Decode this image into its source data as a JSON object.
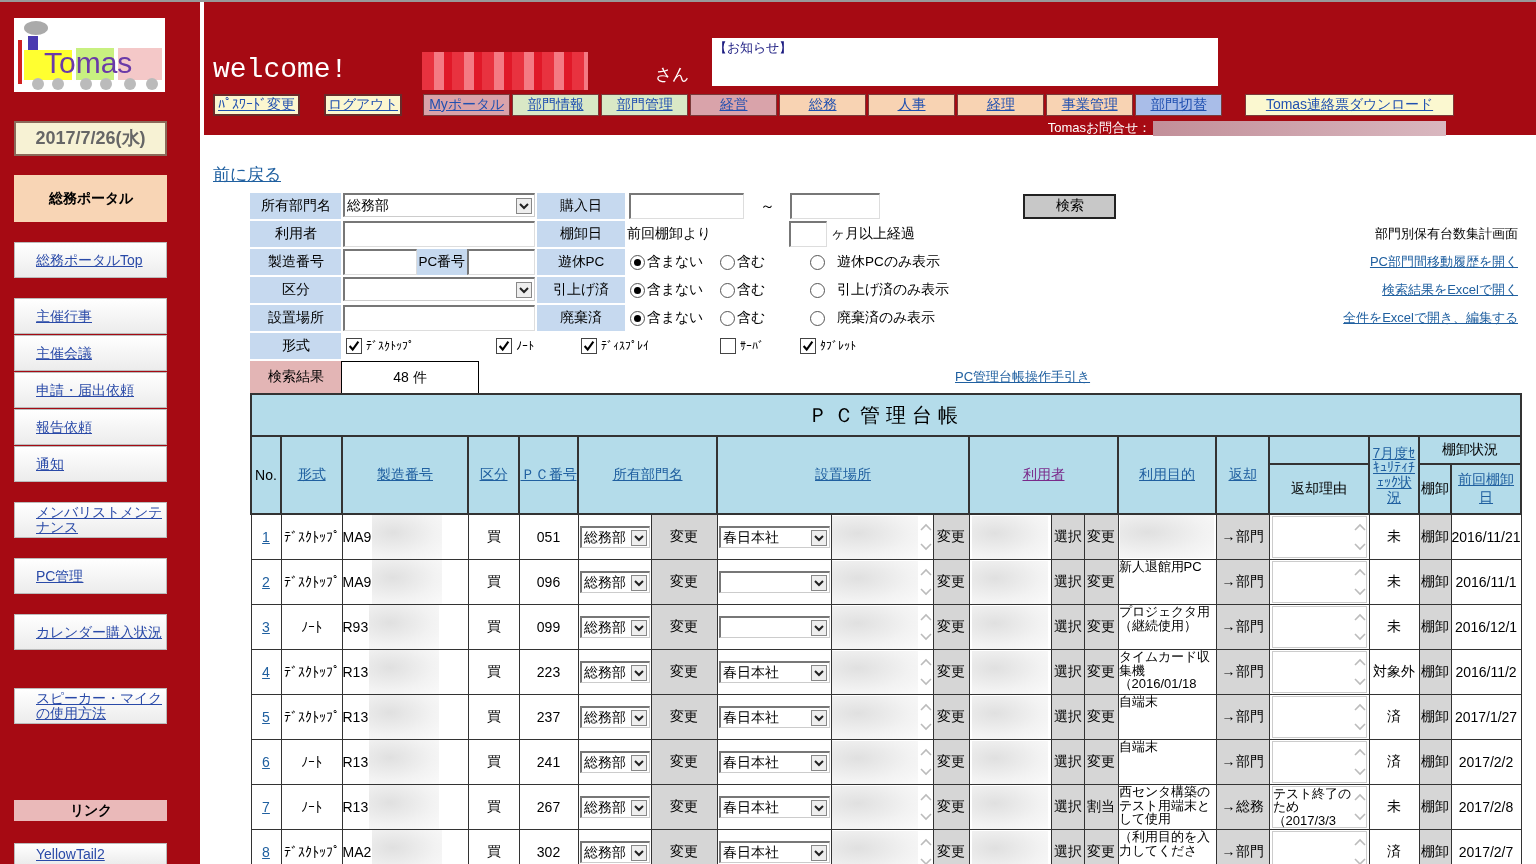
{
  "logo": {
    "text": "Tomas"
  },
  "sidebar": {
    "date": "2017/7/26(水)",
    "portal_title": "総務ポータル",
    "link_groups": [
      [
        "総務ポータルTop"
      ],
      [
        "主催行事",
        "主催会議",
        "申請・届出依頼",
        "報告依頼",
        "通知"
      ],
      [
        "メンバリストメンテナンス"
      ],
      [
        "PC管理"
      ],
      [
        "カレンダー購入状況"
      ],
      [
        "スピーカー・マイクの使用方法"
      ]
    ],
    "links_heading": "リンク",
    "external_links": [
      "YellowTail2"
    ]
  },
  "header": {
    "welcome": "welcome!",
    "honorific": "さん",
    "notice_title": "【お知らせ】",
    "nav": [
      {
        "label": "ﾊﾟｽﾜｰﾄﾞ変更",
        "kind": "account"
      },
      {
        "label": "ログアウト",
        "kind": "account"
      },
      {
        "label": "Myポータル",
        "kind": "tab",
        "color": "#d9a3aa"
      },
      {
        "label": "部門情報",
        "kind": "tab",
        "color": "#d9e8c6"
      },
      {
        "label": "部門管理",
        "kind": "tab",
        "color": "#d9e8c6"
      },
      {
        "label": "経営",
        "kind": "tab",
        "color": "#d9a3aa"
      },
      {
        "label": "総務",
        "kind": "tab",
        "color": "#f8d3b3"
      },
      {
        "label": "人事",
        "kind": "tab",
        "color": "#f8d3b3"
      },
      {
        "label": "経理",
        "kind": "tab",
        "color": "#f8d3b3"
      },
      {
        "label": "事業管理",
        "kind": "tab",
        "color": "#f8d3b3"
      },
      {
        "label": "部門切替",
        "kind": "tab",
        "color": "#a9bde8"
      },
      {
        "label": "Tomas連絡票ダウンロード",
        "kind": "download"
      }
    ],
    "contact_label": "Tomasお問合せ："
  },
  "back_link": "前に戻る",
  "search": {
    "owner_dept": {
      "label": "所有部門名",
      "value": "総務部"
    },
    "purchase_date": {
      "label": "購入日",
      "separator": "～"
    },
    "search_button": "検索",
    "user": {
      "label": "利用者"
    },
    "inventory": {
      "label": "棚卸日",
      "prefix": "前回棚卸より",
      "suffix": "ヶ月以上経過"
    },
    "serial": {
      "label": "製造番号"
    },
    "pc_number": {
      "label": "PC番号"
    },
    "category": {
      "label": "区分"
    },
    "location": {
      "label": "設置場所"
    },
    "radio_groups": [
      {
        "label": "遊休PC",
        "options": [
          {
            "label": "含まない",
            "selected": true
          },
          {
            "label": "含む",
            "selected": false
          },
          {
            "label": "遊休PCのみ表示",
            "selected": false
          }
        ]
      },
      {
        "label": "引上げ済",
        "options": [
          {
            "label": "含まない",
            "selected": true
          },
          {
            "label": "含む",
            "selected": false
          },
          {
            "label": "引上げ済のみ表示",
            "selected": false
          }
        ]
      },
      {
        "label": "廃棄済",
        "options": [
          {
            "label": "含まない",
            "selected": true
          },
          {
            "label": "含む",
            "selected": false
          },
          {
            "label": "廃棄済のみ表示",
            "selected": false
          }
        ]
      }
    ],
    "type_filter": {
      "label": "形式",
      "options": [
        {
          "label": "ﾃﾞｽｸﾄｯﾌﾟ",
          "checked": true
        },
        {
          "label": "ﾉｰﾄ",
          "checked": true
        },
        {
          "label": "ﾃﾞｨｽﾌﾟﾚｲ",
          "checked": true
        },
        {
          "label": "ｻｰﾊﾞ",
          "checked": false
        },
        {
          "label": "ﾀﾌﾞﾚｯﾄ",
          "checked": true
        }
      ]
    },
    "side_links": [
      {
        "text": "部門別保有台数集計画面",
        "kind": "text"
      },
      {
        "text": "PC部門間移動履歴を開く",
        "kind": "link"
      },
      {
        "text": "検索結果をExcelで開く",
        "kind": "link"
      },
      {
        "text": "全件をExcelで開き、編集する",
        "kind": "link"
      }
    ]
  },
  "result": {
    "label": "検索結果",
    "count": "48 件",
    "manual_link": "PC管理台帳操作手引き"
  },
  "table": {
    "title": "ＰＣ管理台帳",
    "columns": [
      {
        "label": "No.",
        "kind": "text"
      },
      {
        "label": "形式",
        "kind": "link"
      },
      {
        "label": "製造番号",
        "kind": "link"
      },
      {
        "label": "区分",
        "kind": "link"
      },
      {
        "label": "ＰＣ番号",
        "kind": "link"
      },
      {
        "label": "所有部門名",
        "kind": "link"
      },
      {
        "label": "設置場所",
        "kind": "link"
      },
      {
        "label": "利用者",
        "kind": "visited_link"
      },
      {
        "label": "利用目的",
        "kind": "link"
      },
      {
        "label": "返却",
        "kind": "link"
      },
      {
        "label": "返却理由",
        "kind": "text"
      },
      {
        "label": "7月度ｾｷｭﾘﾃｨﾁｪｯｸ状況",
        "kind": "link"
      },
      {
        "label": "棚卸状況",
        "kind": "text",
        "children": [
          {
            "label": "棚卸",
            "kind": "text"
          },
          {
            "label": "前回棚卸日",
            "kind": "link"
          }
        ]
      }
    ],
    "rows": [
      {
        "no": "1",
        "type": "ﾃﾞｽｸﾄｯﾌﾟ",
        "serial": "MA9",
        "category": "買",
        "pc_number": "051",
        "dept": "総務部",
        "dept_button": "変更",
        "location": "春日本社",
        "location_button": "変更",
        "select_button": "選択",
        "user_button": "変更",
        "return_button": "→部門",
        "security": "未",
        "inventory_button": "棚卸",
        "last_inventory": "2016/11/21"
      },
      {
        "no": "2",
        "type": "ﾃﾞｽｸﾄｯﾌﾟ",
        "serial": "MA9",
        "category": "買",
        "pc_number": "096",
        "dept": "総務部",
        "dept_button": "変更",
        "location_button": "変更",
        "select_button": "選択",
        "user_button": "変更",
        "purpose": "新人退館用PC",
        "return_button": "→部門",
        "security": "未",
        "inventory_button": "棚卸",
        "last_inventory": "2016/11/1"
      },
      {
        "no": "3",
        "type": "ﾉｰﾄ",
        "serial": "R93",
        "category": "買",
        "pc_number": "099",
        "dept": "総務部",
        "dept_button": "変更",
        "location_button": "変更",
        "select_button": "選択",
        "user_button": "変更",
        "purpose": "プロジェクタ用（継続使用）",
        "return_button": "→部門",
        "security": "未",
        "inventory_button": "棚卸",
        "last_inventory": "2016/12/1"
      },
      {
        "no": "4",
        "type": "ﾃﾞｽｸﾄｯﾌﾟ",
        "serial": "R13",
        "category": "買",
        "pc_number": "223",
        "dept": "総務部",
        "dept_button": "変更",
        "location": "春日本社",
        "location_button": "変更",
        "select_button": "選択",
        "user_button": "変更",
        "purpose": "タイムカード収集機（2016/01/18",
        "return_button": "→部門",
        "security": "対象外",
        "inventory_button": "棚卸",
        "last_inventory": "2016/11/2"
      },
      {
        "no": "5",
        "type": "ﾃﾞｽｸﾄｯﾌﾟ",
        "serial": "R13",
        "category": "買",
        "pc_number": "237",
        "dept": "総務部",
        "dept_button": "変更",
        "location": "春日本社",
        "location_button": "変更",
        "select_button": "選択",
        "user_button": "変更",
        "purpose": "自端末",
        "return_button": "→部門",
        "security": "済",
        "inventory_button": "棚卸",
        "last_inventory": "2017/1/27"
      },
      {
        "no": "6",
        "type": "ﾉｰﾄ",
        "serial": "R13",
        "category": "買",
        "pc_number": "241",
        "dept": "総務部",
        "dept_button": "変更",
        "location": "春日本社",
        "location_button": "変更",
        "select_button": "選択",
        "user_button": "変更",
        "purpose": "自端末",
        "return_button": "→部門",
        "security": "済",
        "inventory_button": "棚卸",
        "last_inventory": "2017/2/2"
      },
      {
        "no": "7",
        "type": "ﾉｰﾄ",
        "serial": "R13",
        "category": "買",
        "pc_number": "267",
        "dept": "総務部",
        "dept_button": "変更",
        "location": "春日本社",
        "location_button": "変更",
        "select_button": "選択",
        "user_button": "割当",
        "purpose": "西センタ構築のテスト用端末として使用",
        "return_button": "→総務",
        "return_reason": "テスト終了のため（2017/3/3",
        "security": "未",
        "inventory_button": "棚卸",
        "last_inventory": "2017/2/8"
      },
      {
        "no": "8",
        "type": "ﾃﾞｽｸﾄｯﾌﾟ",
        "serial": "MA2",
        "category": "買",
        "pc_number": "302",
        "dept": "総務部",
        "dept_button": "変更",
        "location": "春日本社",
        "location_button": "変更",
        "select_button": "選択",
        "user_button": "変更",
        "purpose": "（利用目的を入力してくださ",
        "return_button": "→部門",
        "security": "済",
        "inventory_button": "棚卸",
        "last_inventory": "2017/2/7"
      }
    ]
  }
}
